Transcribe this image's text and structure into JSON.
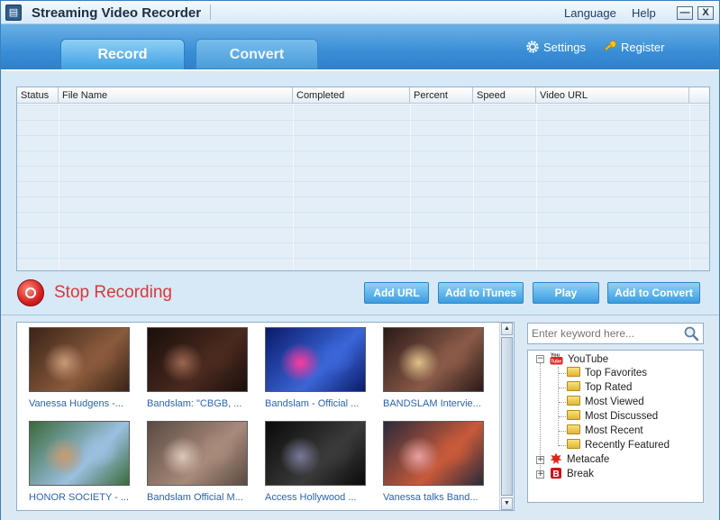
{
  "app": {
    "title": "Streaming Video Recorder",
    "menu": [
      "Language",
      "Help"
    ],
    "minimize_glyph": "—",
    "close_glyph": "X"
  },
  "tabs": [
    {
      "label": "Record",
      "active": true
    },
    {
      "label": "Convert",
      "active": false
    }
  ],
  "header_links": {
    "settings": {
      "label": "Settings",
      "icon": "gear-icon"
    },
    "register": {
      "label": "Register",
      "icon": "key-icon"
    }
  },
  "grid": {
    "columns": [
      "Status",
      "File Name",
      "Completed",
      "Percent",
      "Speed",
      "Video URL"
    ],
    "rows": []
  },
  "actions": {
    "stop_recording": "Stop Recording",
    "buttons": [
      "Add URL",
      "Add to iTunes",
      "Play",
      "Add to Convert"
    ]
  },
  "videos": [
    {
      "caption": "Vanessa Hudgens -...",
      "palette": [
        "#3a2418",
        "#8a5a3c",
        "#c99a78"
      ]
    },
    {
      "caption": "Bandslam: \"CBGB, ...",
      "palette": [
        "#1a0e0c",
        "#4a2a1e",
        "#9a6650"
      ]
    },
    {
      "caption": "Bandslam - Official ...",
      "palette": [
        "#0a1a6a",
        "#3a66d8",
        "#ff3aa0"
      ]
    },
    {
      "caption": "BANDSLAM Intervie...",
      "palette": [
        "#2a1a18",
        "#8a5a48",
        "#e0c08a"
      ]
    },
    {
      "caption": "HONOR SOCIETY - ...",
      "palette": [
        "#3a6a3a",
        "#9ac0e0",
        "#c89a70"
      ]
    },
    {
      "caption": "Bandslam Official M...",
      "palette": [
        "#5a4a42",
        "#a88a7a",
        "#dcc7b8"
      ]
    },
    {
      "caption": "Access Hollywood ...",
      "palette": [
        "#0a0a0a",
        "#3a3a3a",
        "#7a7a9a"
      ]
    },
    {
      "caption": "Vanessa talks Band...",
      "palette": [
        "#2a2a3a",
        "#c85a3a",
        "#e8a0a0"
      ]
    }
  ],
  "search": {
    "placeholder": "Enter keyword here...",
    "icon": "magnifier-icon"
  },
  "tree": {
    "sites": [
      {
        "label": "YouTube",
        "expanded": true,
        "children": [
          "Top Favorites",
          "Top Rated",
          "Most Viewed",
          "Most Discussed",
          "Most Recent",
          "Recently Featured"
        ]
      },
      {
        "label": "Metacafe",
        "expanded": false,
        "children": []
      },
      {
        "label": "Break",
        "expanded": false,
        "children": []
      }
    ],
    "expand_glyph": "+",
    "collapse_glyph": "−"
  },
  "colors": {
    "accent": "#3a8ed6",
    "stop_red": "#d8383a",
    "link_blue": "#2b63b0"
  }
}
